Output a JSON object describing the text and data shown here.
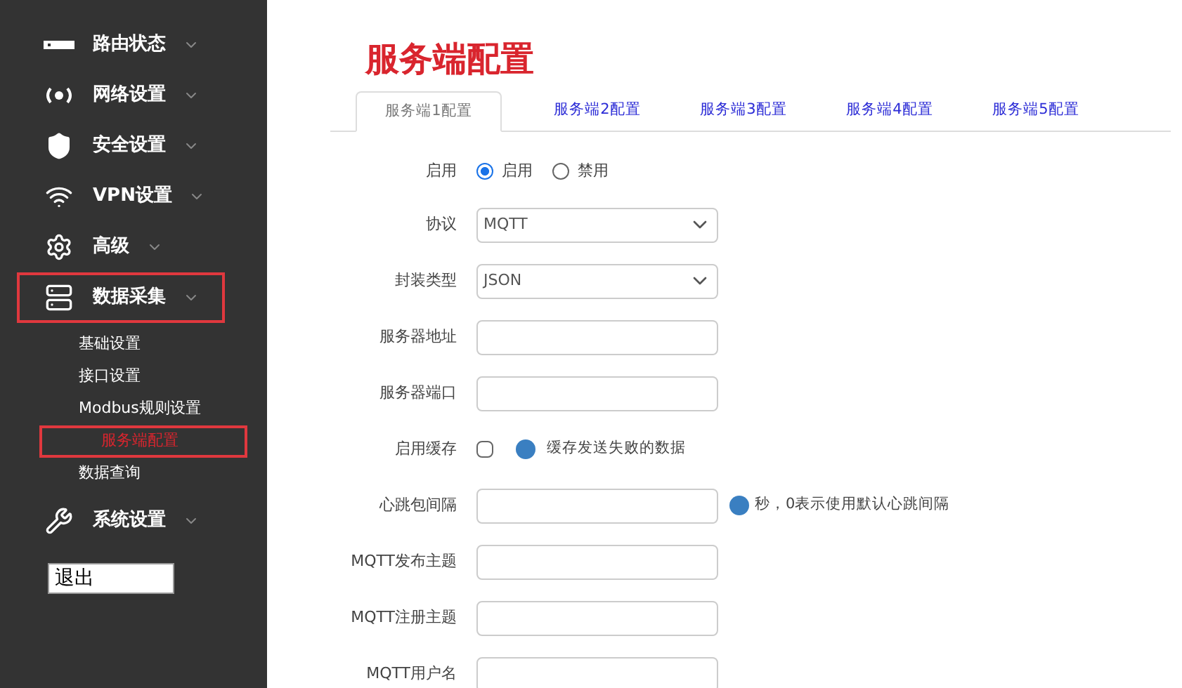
{
  "sidebar": {
    "items": [
      {
        "label": "路由状态",
        "highlighted": false
      },
      {
        "label": "网络设置",
        "highlighted": false
      },
      {
        "label": "安全设置",
        "highlighted": false
      },
      {
        "label": "VPN设置",
        "highlighted": false
      },
      {
        "label": "高级",
        "highlighted": false
      },
      {
        "label": "数据采集",
        "highlighted": true,
        "children": [
          {
            "label": "基础设置",
            "selected": false,
            "highlighted": false
          },
          {
            "label": "接口设置",
            "selected": false,
            "highlighted": false
          },
          {
            "label": "Modbus规则设置",
            "selected": false,
            "highlighted": false
          },
          {
            "label": "服务端配置",
            "selected": true,
            "highlighted": true
          },
          {
            "label": "数据查询",
            "selected": false,
            "highlighted": false
          }
        ]
      },
      {
        "label": "系统设置",
        "highlighted": false
      }
    ],
    "logout": "退出"
  },
  "page": {
    "title": "服务端配置",
    "tabs": [
      {
        "label": "服务端1配置",
        "selected": true
      },
      {
        "label": "服务端2配置",
        "selected": false
      },
      {
        "label": "服务端3配置",
        "selected": false
      },
      {
        "label": "服务端4配置",
        "selected": false
      },
      {
        "label": "服务端5配置",
        "selected": false
      }
    ],
    "form": [
      {
        "kind": "radio",
        "label": "启用",
        "options": [
          {
            "label": "启用",
            "selected": true
          },
          {
            "label": "禁用",
            "selected": false
          }
        ]
      },
      {
        "kind": "select",
        "label": "协议",
        "value": "MQTT"
      },
      {
        "kind": "select",
        "label": "封装类型",
        "value": "JSON"
      },
      {
        "kind": "text",
        "label": "服务器地址"
      },
      {
        "kind": "text",
        "label": "服务器端口"
      },
      {
        "kind": "checkbox",
        "label": "启用缓存",
        "checked": false,
        "hint": "缓存发送失败的数据"
      },
      {
        "kind": "text",
        "label": "心跳包间隔",
        "hint": "秒，0表示使用默认心跳间隔"
      },
      {
        "kind": "text",
        "label": "MQTT发布主题"
      },
      {
        "kind": "text",
        "label": "MQTT注册主题"
      },
      {
        "kind": "text",
        "label": "MQTT用户名"
      }
    ]
  }
}
